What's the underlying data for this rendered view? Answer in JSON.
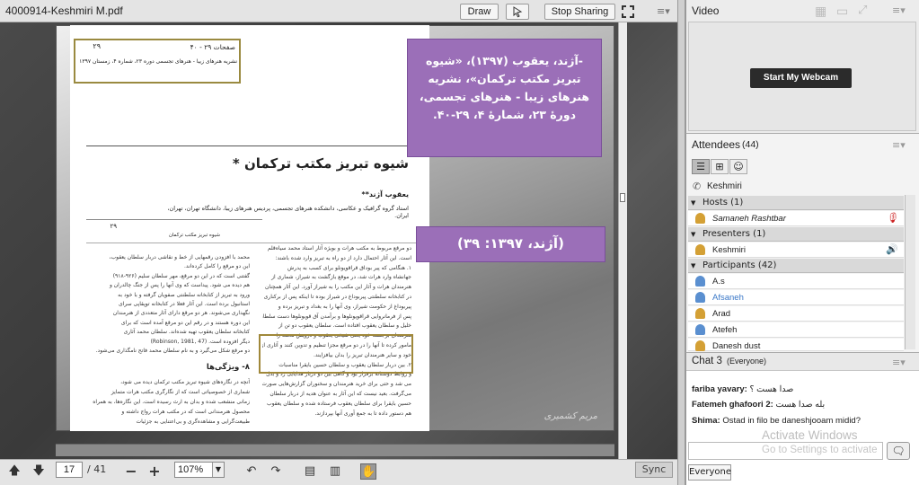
{
  "share": {
    "file_title": "4000914-Keshmiri M.pdf",
    "draw_label": "Draw",
    "stop_sharing_label": "Stop Sharing",
    "menu_icon": "menu-lines-icon"
  },
  "document": {
    "cite_pages": "صفحات ۲۹ - ۴۰",
    "cite_page_no": "۲۹",
    "cite_journal": "نشریه هنرهای زیبا - هنرهای تجسمی دوره ۲۳، شماره ۴، زمستان ۱۳۹۷",
    "title": "شیوه تبریز مکتب ترکمان *",
    "author": "یعقوب آژند**",
    "affiliation": "استاد گروه گرافیک و عکاسی، دانشکده هنرهای تجسمی، پردیس هنرهای زیبا، دانشگاه تهران، تهران، ایران.",
    "page_no2": "۲۹",
    "running_head": "شیوه تبریز مکتب ترکمان",
    "section_heading": "۸- ویژگی‌ها",
    "body_right": [
      "دو مرقع مربوط به مکتب هرات و بویژه آثار استاد محمد سیاه‌قلم",
      "است. این آثار احتمال دارد از دو راه به تبریز وارد شده باشند:",
      "۱. هنگامی که پیر بوداق قراقویونلو برای کسب به پدرش",
      "جهانشاه وارد هرات شد، در موقع بازگشت به شیراز، شماری از",
      "هنرمندان هرات و آثار این مکتب را به شیراز آورد. این آثار همچنان",
      "در کتابخانه سلطنتی پیربوداغ در شیراز بوده تا اینکه پس از برکناری",
      "پیربوداغ از حکومت شیراز، وی آنها را به بغداد و تبریز برده و",
      "پس از فرمانروایی قراقویونلوها و برآمدن آق قویونلوها دست سلطان",
      "خلیل و سلطان یعقوب افتاده است. سلطان یعقوب دو تن از",
      "هنرمندان برجسته خود یعنی شیخی یعقوب و درویش محمد را",
      "مامور کرده تا آنها را در دو مرقع مجزا تنظیم و تدوین کنند و آثاری از",
      "خود و سایر هنرمندان تبریز را بدان بیافزایند.",
      "۲. بین دربار سلطان یعقوب و سلطان حسین بایقرا مناسبات",
      "و روابط دوستانه برقرار بود و گاهی بین دو دربار هدایایی رد و بدل",
      "می شد و حتی برای خرید هنرمندان و سخنوران گزارش‌هایی صورت",
      "می‌گرفت. بعید نیست که این آثار به عنوان هدیه از دربار سلطان",
      "حسین بایقرا برای سلطان یعقوب فرستاده شده و سلطان یعقوب",
      "هم دستور داده تا به جمع آوری آنها بپردازند."
    ],
    "body_left": [
      "محمد با افزودن رقمهایی از خط و نقاشی دربار سلطان یعقوب،",
      "این دو مرقع را کامل کرده‌اند.",
      "گفتنی است که در این دو مرقع، مهر سلطان سلیم (۹۲۶-۹۱۸)",
      "هم دیده می شود. پیداست که وی آنها را پس از جنگ چالدران و",
      "ورود به تبریز از کتابخانه سلطنتی صفویان گرفته و با خود به",
      "استانبول برده است. این آثار فعلا در کتابخانه توپقاپی سرای",
      "نگهداری می‌شوند. هر دو مرقع دارای آثار متعددی از هنرمندان",
      "این دوره هستند و در رقم این دو مرقع آمده است که برای",
      "کتابخانه سلطان یعقوب تهیه شده‌اند. سلطان محمد آثاری",
      "دیگر افزوده است. (Robinson, 1981, 47)",
      "دو مرقع شکل می‌گیرد و به نام سلطان محمد فاتح نامگذاری می‌شود."
    ],
    "body_bottom": [
      "آنچه در نگاره‌های شیوه تبریز مکتب ترکمان دیده می شود،",
      "شماری از خصوصیاتی است که از نگارگری مکتب هرات متمایز",
      "زمانی منشعب شده و بدان به ارث رسیده است. این نگاره‌ها، به همراه",
      "محصول هنرمندانی است که در مکتب هرات رواج داشته و",
      "طبیعت‌گرایی و مشاهده‌گری و بی‌اعتنایی به جزئیات"
    ],
    "watermark": "مریم کشمیری"
  },
  "annotations": {
    "citation_full": "-آژند، یعقوب (۱۳۹۷)، «شیوه تبریز مکتب ترکمان»، نشریه هنرهای زیبا - هنرهای تجسمی، دورهٔ ۲۳، شمارهٔ ۴، ۲۹-۴۰.",
    "citation_short": "(آژند، ۱۳۹۷: ۳۹)"
  },
  "bottom_bar": {
    "page_current": "17",
    "page_total": "/ 41",
    "zoom": "107%",
    "sync_label": "Sync"
  },
  "video": {
    "title": "Video",
    "webcam_label": "Start My Webcam"
  },
  "attendees": {
    "title": "Attendees",
    "count": "(44)",
    "current_user": "Keshmiri",
    "hosts_label": "Hosts (1)",
    "hosts": [
      "Samaneh Rashtbar"
    ],
    "presenters_label": "Presenters (1)",
    "presenters": [
      "Keshmiri"
    ],
    "participants_label": "Participants (42)",
    "participants": [
      "A.s",
      "Afsaneh",
      "Arad",
      "Atefeh",
      "Danesh dust"
    ]
  },
  "chat": {
    "title": "Chat 3",
    "scope": "(Everyone)",
    "messages": [
      {
        "sender": "fariba yavary:",
        "text": "صدا هست ؟"
      },
      {
        "sender": "Fatemeh ghafoori 2:",
        "text": "بله صدا هست"
      },
      {
        "sender": "Shima:",
        "text": "Ostad in filo be daneshjooam midid?"
      }
    ],
    "everyone_label": "Everyone",
    "activate_line1": "Activate Windows",
    "activate_line2": "Go to Settings to activate"
  },
  "colors": {
    "annotation_purple": "#9b6fb8",
    "highlight_border": "#9a8a40",
    "afsaneh_blue": "#3a78c8"
  }
}
